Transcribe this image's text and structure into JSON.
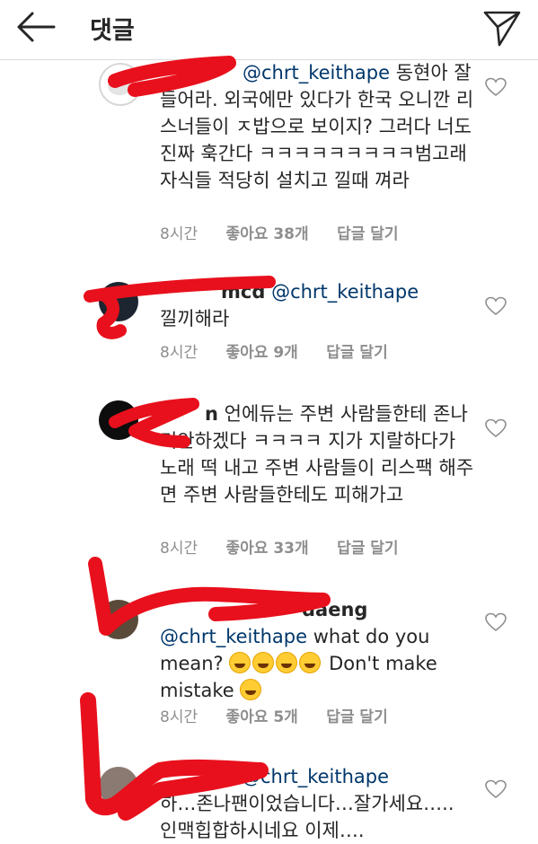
{
  "header": {
    "title": "댓글"
  },
  "comments": [
    {
      "username": "",
      "mention": "@chrt_keithape",
      "text": " 동현아 잘들어라. 외국에만 있다가 한국 오니깐 리스너들이 ㅈ밥으로 보이지? 그러다 너도 진짜 훅간다 ㅋㅋㅋㅋㅋㅋㅋㅋㅋ범고래자식들 적당히 설치고 낄때 껴라",
      "time": "8시간",
      "likes": "좋아요 38개",
      "reply": "답글 달기"
    },
    {
      "username": "mcd",
      "mention": "@chrt_keithape",
      "text": " 낄끼해라",
      "time": "8시간",
      "likes": "좋아요 9개",
      "reply": "답글 달기"
    },
    {
      "username": "n",
      "mention": "",
      "text": " 언에듀는 주변 사람들한테 존나 미안하겠다 ㅋㅋㅋㅋ 지가 지랄하다가 노래 떡 내고 주변 사람들이 리스팩 해주면 주변 사람들한테도 피해가고",
      "time": "8시간",
      "likes": "좋아요 33개",
      "reply": "답글 달기"
    },
    {
      "username": "daeng",
      "mention": "@chrt_keithape",
      "text": " what do you mean?",
      "text2": " Don't make mistake",
      "time": "8시간",
      "likes": "좋아요 5개",
      "reply": "답글 달기"
    },
    {
      "username": "bit",
      "mention": "@chrt_keithape",
      "text": " 하…존나팬이었습니다…잘가세요….. 인맥힙합하시네요 이제….",
      "time": "",
      "likes": "",
      "reply": ""
    }
  ],
  "colors": {
    "mention": "#00376b",
    "meta": "#8e8e8e",
    "scribble": "#e8101c"
  },
  "icons": [
    "back-arrow-icon",
    "send-icon",
    "heart-icon"
  ]
}
